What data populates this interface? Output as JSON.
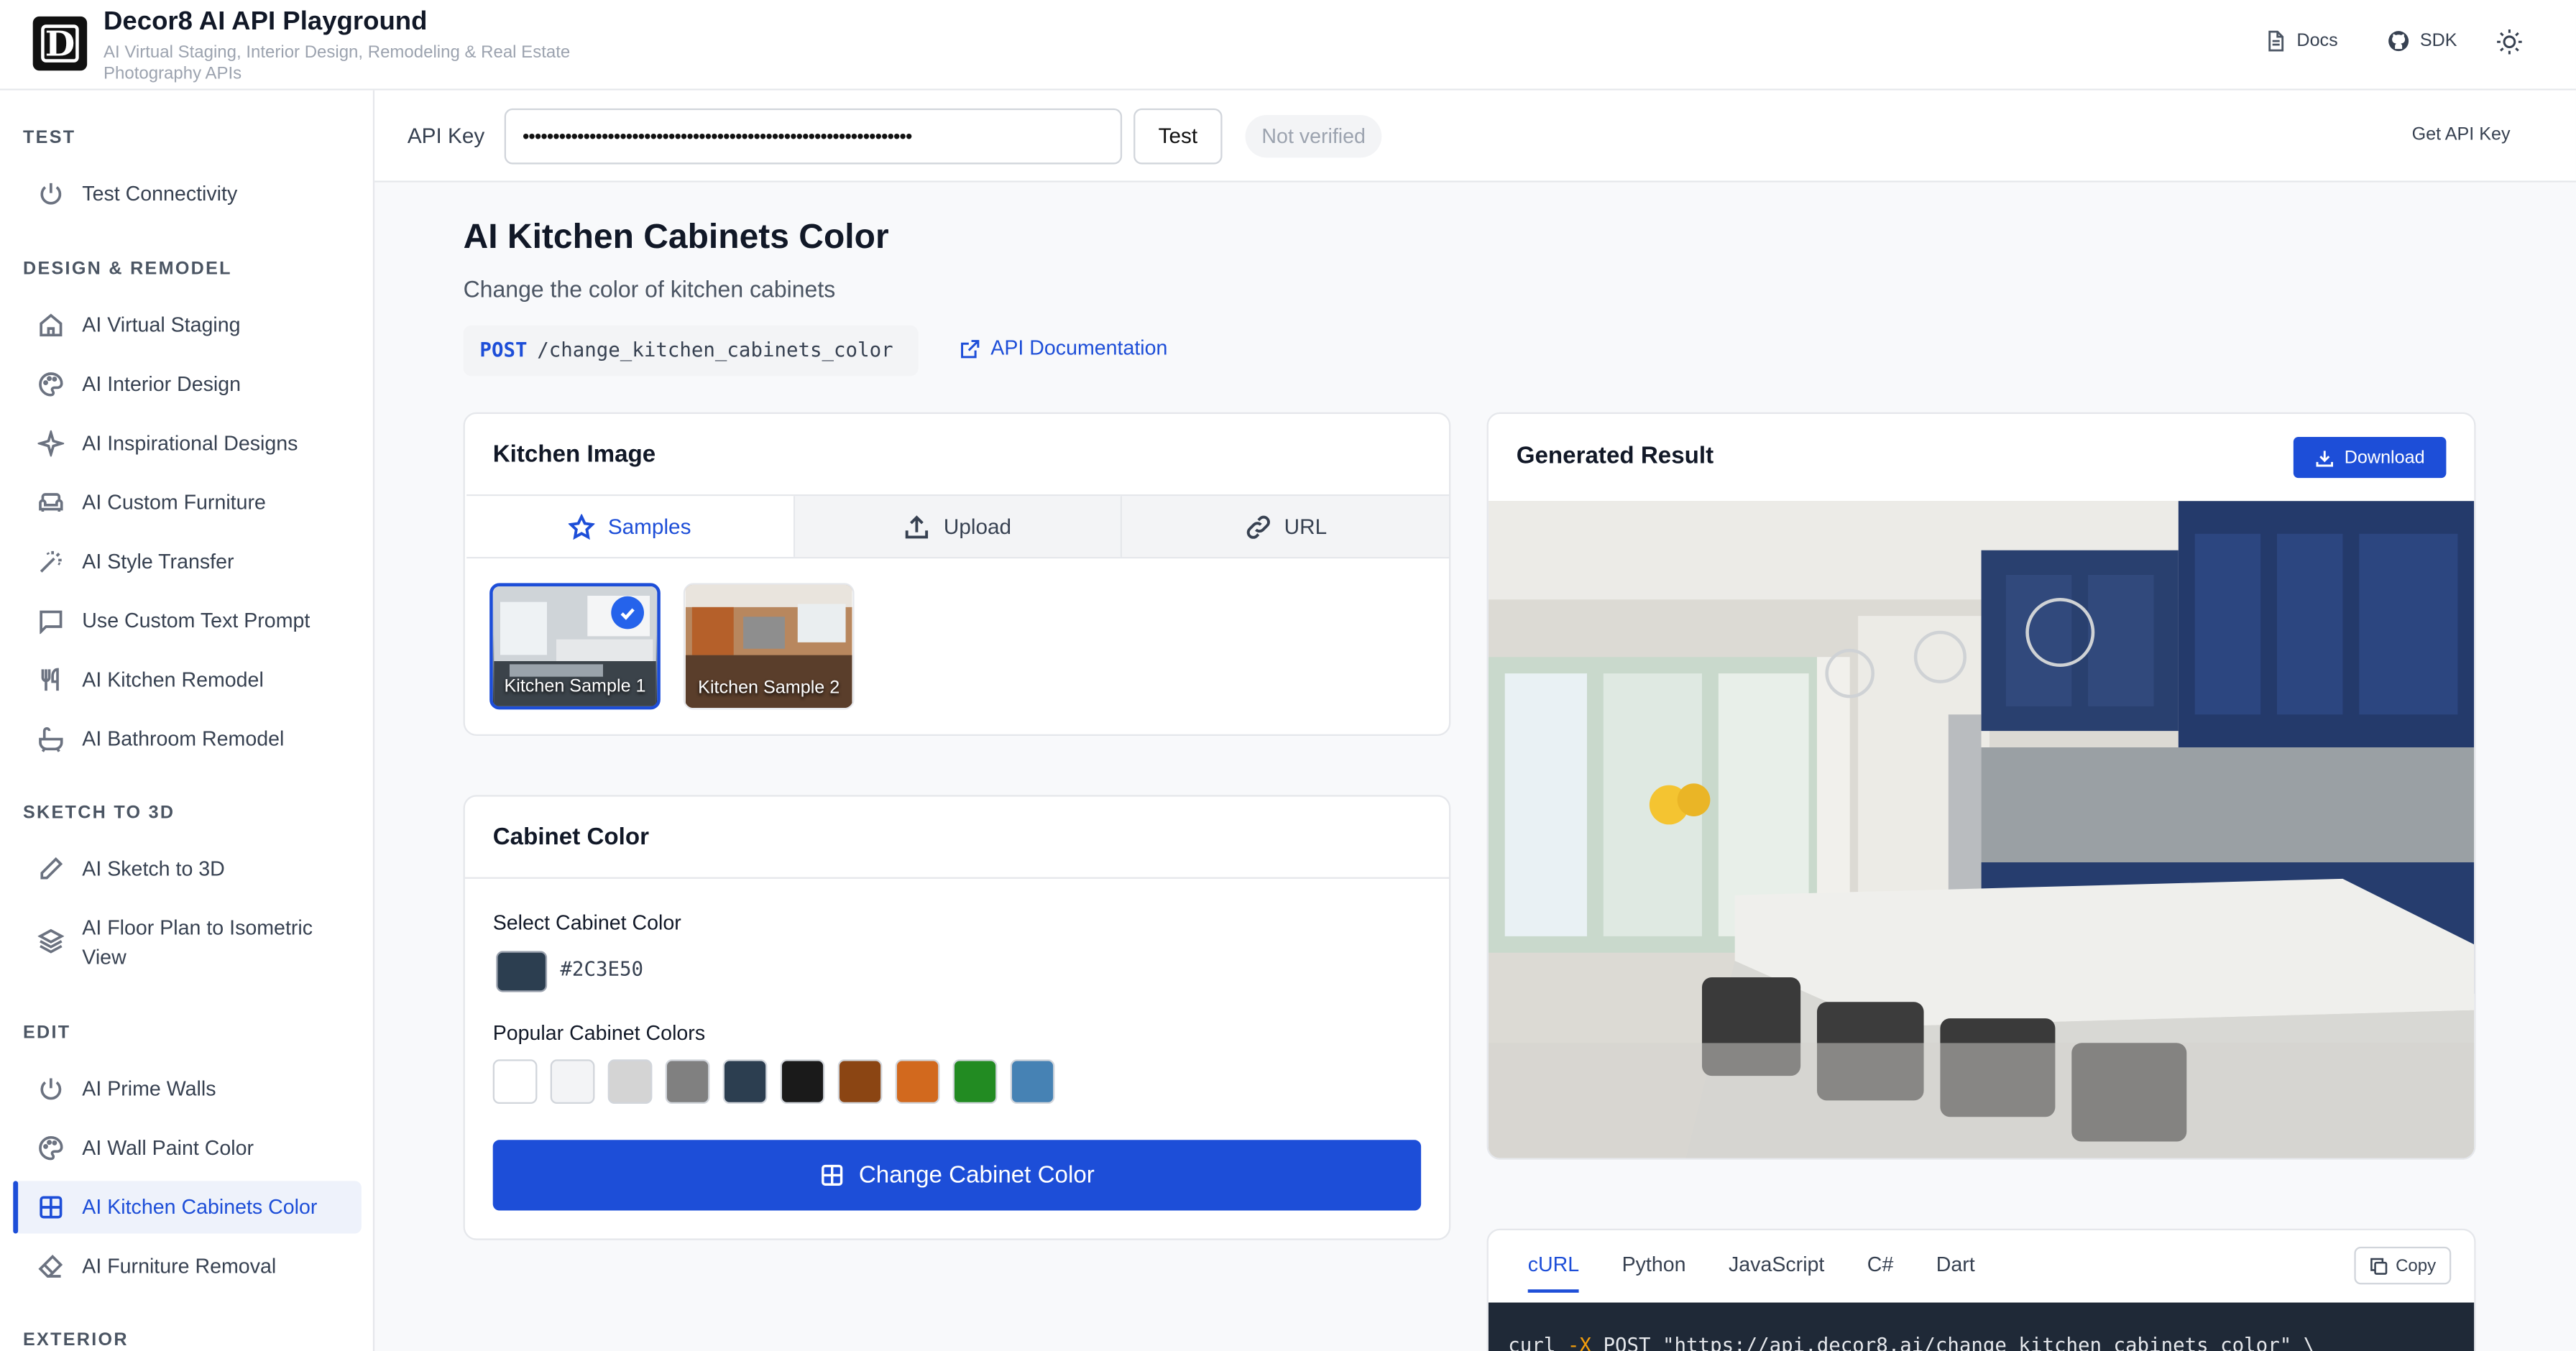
{
  "header": {
    "logo_letter": "D",
    "title": "Decor8 AI API Playground",
    "subtitle": "AI Virtual Staging, Interior Design, Remodeling & Real Estate Photography APIs",
    "docs": "Docs",
    "sdk": "SDK"
  },
  "sidebar": {
    "sections": {
      "test": "TEST",
      "design": "DESIGN & REMODEL",
      "sketch": "SKETCH TO 3D",
      "edit": "EDIT",
      "exterior": "EXTERIOR"
    },
    "items": [
      "Test Connectivity",
      "AI Virtual Staging",
      "AI Interior Design",
      "AI Inspirational Designs",
      "AI Custom Furniture",
      "AI Style Transfer",
      "Use Custom Text Prompt",
      "AI Kitchen Remodel",
      "AI Bathroom Remodel",
      "AI Sketch to 3D",
      "AI Floor Plan to Isometric View",
      "AI Prime Walls",
      "AI Wall Paint Color",
      "AI Kitchen Cabinets Color",
      "AI Furniture Removal"
    ]
  },
  "apibar": {
    "label": "API Key",
    "value": "••••••••••••••••••••••••••••••••••••••••••••••••••••••••••••••••",
    "test": "Test",
    "status": "Not verified",
    "get_key": "Get API Key"
  },
  "page": {
    "title": "AI Kitchen Cabinets Color",
    "subtitle": "Change the color of kitchen cabinets",
    "method": "POST",
    "path": "/change_kitchen_cabinets_color",
    "doc_link": "API Documentation"
  },
  "kitchen_image": {
    "title": "Kitchen Image",
    "tabs": [
      "Samples",
      "Upload",
      "URL"
    ],
    "samples": [
      "Kitchen Sample 1",
      "Kitchen Sample 2"
    ]
  },
  "cabinet": {
    "title": "Cabinet Color",
    "select_label": "Select Cabinet Color",
    "selected_hex": "#2C3E50",
    "popular_label": "Popular Cabinet Colors",
    "popular": [
      "#FFFFFF",
      "#F3F4F6",
      "#D4D4D4",
      "#808080",
      "#2C3E50",
      "#1A1A1A",
      "#8B4513",
      "#D2691E",
      "#228B22",
      "#4682B4"
    ],
    "button": "Change Cabinet Color"
  },
  "result": {
    "title": "Generated Result",
    "download": "Download"
  },
  "code": {
    "tabs": [
      "cURL",
      "Python",
      "JavaScript",
      "C#",
      "Dart"
    ],
    "copy": "Copy",
    "snippet_cmd": "curl",
    "snippet_flag": "-X",
    "snippet_rest": "POST \"https://api.decor8.ai/change_kitchen_cabinets_color\" \\"
  }
}
